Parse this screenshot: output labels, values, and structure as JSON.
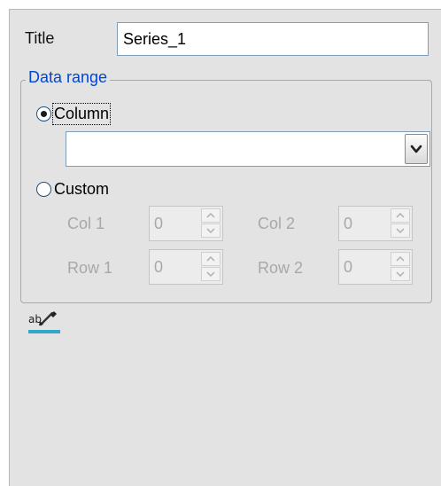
{
  "title_field": {
    "label": "Title",
    "value": "Series_1"
  },
  "data_range": {
    "legend": "Data range",
    "column_option": {
      "label": "Column",
      "selected": true
    },
    "column_combo": {
      "value": "",
      "dropdown_icon": "chevron-down-icon"
    },
    "custom_option": {
      "label": "Custom",
      "selected": false
    },
    "col1": {
      "label": "Col 1",
      "value": "0"
    },
    "col2": {
      "label": "Col 2",
      "value": "0"
    },
    "row1": {
      "label": "Row 1",
      "value": "0"
    },
    "row2": {
      "label": "Row 2",
      "value": "0"
    }
  },
  "label_style_button": {
    "icon": "label-edit-icon",
    "underline_color": "#33a6cc"
  },
  "colors": {
    "panel_background": "#e3e3e3",
    "group_legend": "#0046d5",
    "disabled_text": "#a8a8a8"
  }
}
